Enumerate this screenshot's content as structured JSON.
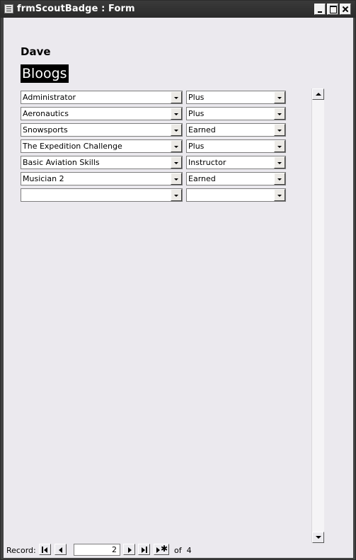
{
  "window": {
    "title": "frmScoutBadge : Form"
  },
  "person": {
    "first_name": "Dave",
    "last_name": "Bloogs"
  },
  "badges": [
    {
      "badge": "Administrator",
      "level": "Plus"
    },
    {
      "badge": "Aeronautics",
      "level": "Plus"
    },
    {
      "badge": "Snowsports",
      "level": "Earned"
    },
    {
      "badge": "The Expedition Challenge",
      "level": "Plus"
    },
    {
      "badge": "Basic Aviation Skills",
      "level": "Instructor"
    },
    {
      "badge": "Musician 2",
      "level": "Earned"
    },
    {
      "badge": "",
      "level": ""
    }
  ],
  "navigation": {
    "label": "Record:",
    "current": "2",
    "of_label": "of",
    "total": "4"
  }
}
